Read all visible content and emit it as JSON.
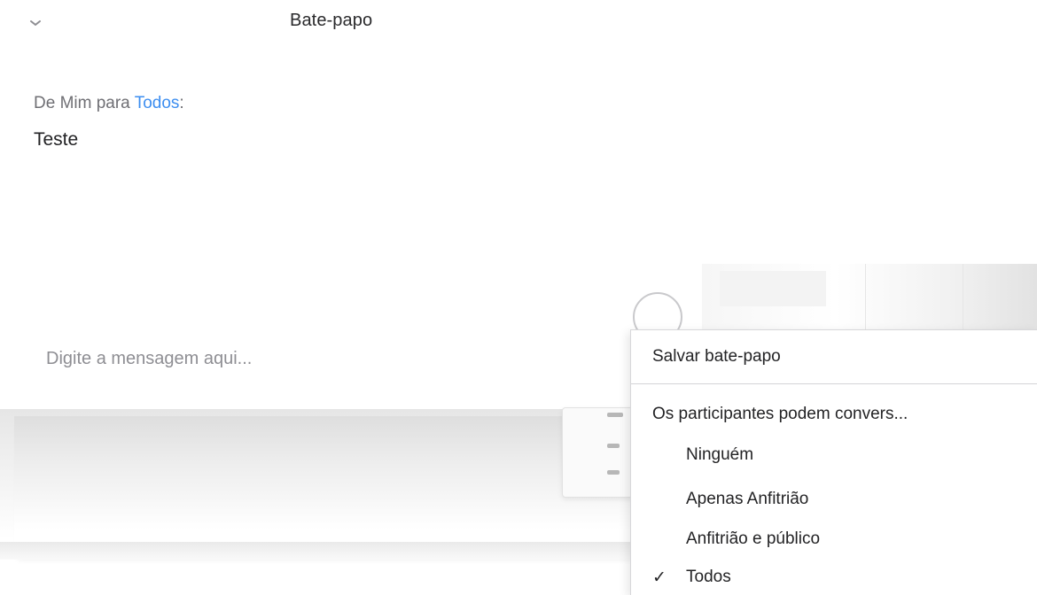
{
  "chat": {
    "title": "Bate-papo",
    "message": {
      "from": "De Mim para",
      "to": "Todos",
      "suffix": ":",
      "text": "Teste"
    },
    "input_placeholder": "Digite a mensagem aqui..."
  },
  "menu": {
    "save_chat": "Salvar bate-papo",
    "permissions_header": "Os participantes podem convers...",
    "options": [
      {
        "label": "Ninguém",
        "checked": false
      },
      {
        "label": "Apenas Anfitrião",
        "checked": false
      },
      {
        "label": "Anfitrião e público",
        "checked": false
      },
      {
        "label": "Todos",
        "checked": true
      }
    ],
    "check_glyph": "✓"
  },
  "icons": {
    "collapse": "chevron-down-icon",
    "check": "check-icon"
  },
  "colors": {
    "link_blue": "#3d8ef0",
    "text_gray": "#6f6f74",
    "text_dark": "#232325",
    "menu_border": "#d7d7da"
  }
}
